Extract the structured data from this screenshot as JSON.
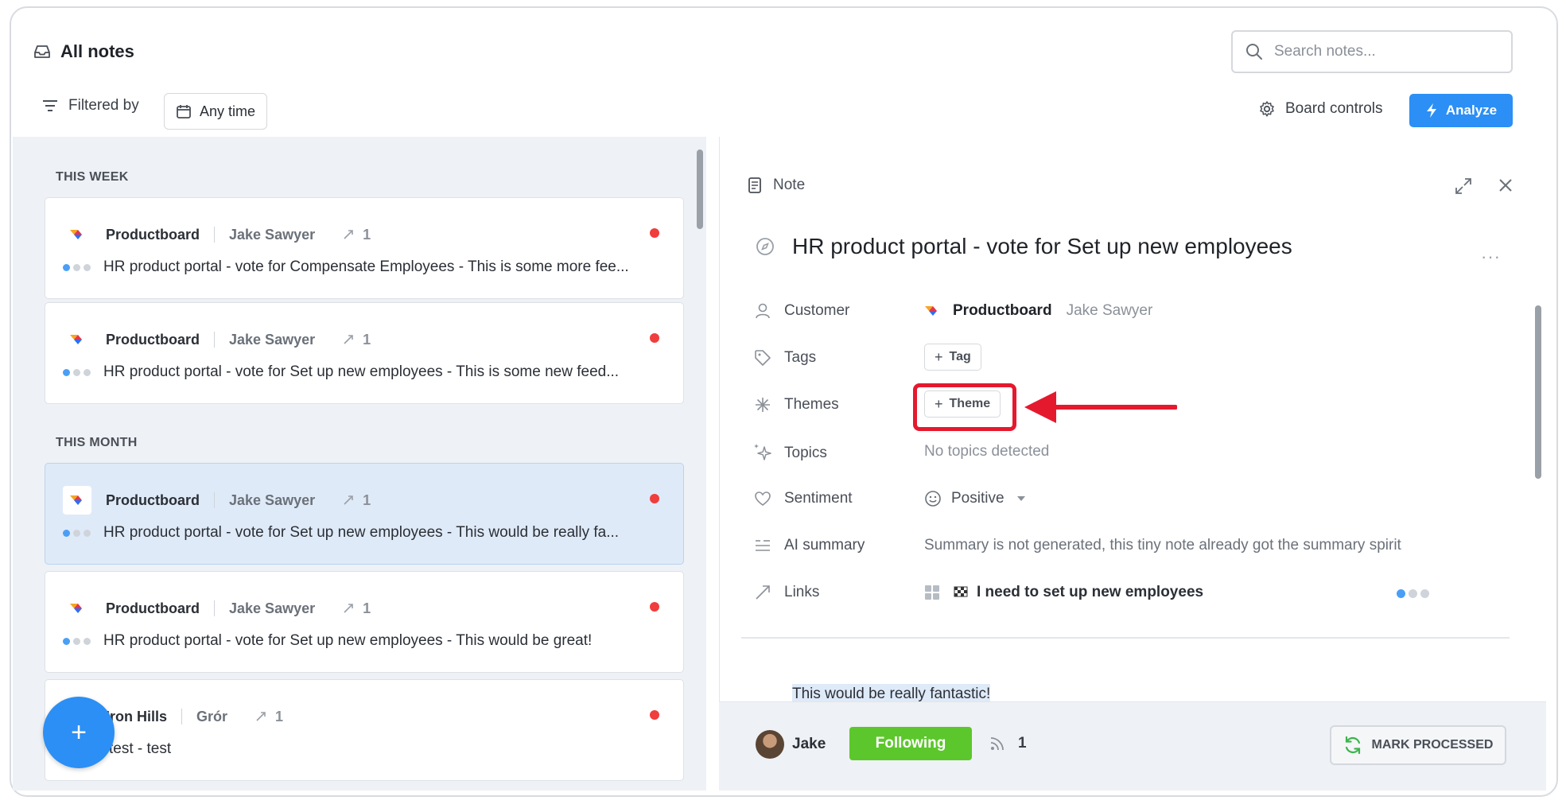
{
  "header": {
    "title": "All notes",
    "search_placeholder": "Search notes...",
    "filtered_by": "Filtered by",
    "time_filter": "Any time",
    "board_controls": "Board controls",
    "analyze": "Analyze"
  },
  "list": {
    "sections": [
      {
        "label": "THIS WEEK",
        "notes": [
          {
            "company": "Productboard",
            "person": "Jake Sawyer",
            "links": "1",
            "snippet": "HR product portal - vote for Compensate Employees - This is some more fee..."
          },
          {
            "company": "Productboard",
            "person": "Jake Sawyer",
            "links": "1",
            "snippet": "HR product portal - vote for Set up new employees - This is some new feed..."
          }
        ]
      },
      {
        "label": "THIS MONTH",
        "notes": [
          {
            "company": "Productboard",
            "person": "Jake Sawyer",
            "links": "1",
            "snippet": "HR product portal - vote for Set up new employees - This would be really fa..."
          },
          {
            "company": "Productboard",
            "person": "Jake Sawyer",
            "links": "1",
            "snippet": "HR product portal - vote for Set up new employees - This would be great!"
          },
          {
            "company": "Iron Hills",
            "person": "Grór",
            "links": "1",
            "snippet": "test - test"
          }
        ]
      }
    ],
    "fab_label": "+"
  },
  "detail": {
    "header_label": "Note",
    "title": "HR product portal - vote for Set up new employees",
    "more": "···",
    "props": {
      "customer_label": "Customer",
      "customer_company": "Productboard",
      "customer_person": "Jake Sawyer",
      "tags_label": "Tags",
      "tag_chip": "Tag",
      "themes_label": "Themes",
      "theme_chip": "Theme",
      "topics_label": "Topics",
      "topics_value": "No topics detected",
      "sentiment_label": "Sentiment",
      "sentiment_value": "Positive",
      "summary_label": "AI summary",
      "summary_value": "Summary is not generated, this tiny note already got the summary spirit",
      "links_label": "Links",
      "links_value": "I need to set up new employees"
    },
    "body": "This would be really fantastic!"
  },
  "footer": {
    "owner": "Jake",
    "following": "Following",
    "followers": "1",
    "mark_processed": "MARK PROCESSED"
  },
  "colors": {
    "accent": "#2b8ff5",
    "following": "#5cc72c",
    "annotation": "#e5192e",
    "unread": "#f03d3d"
  }
}
